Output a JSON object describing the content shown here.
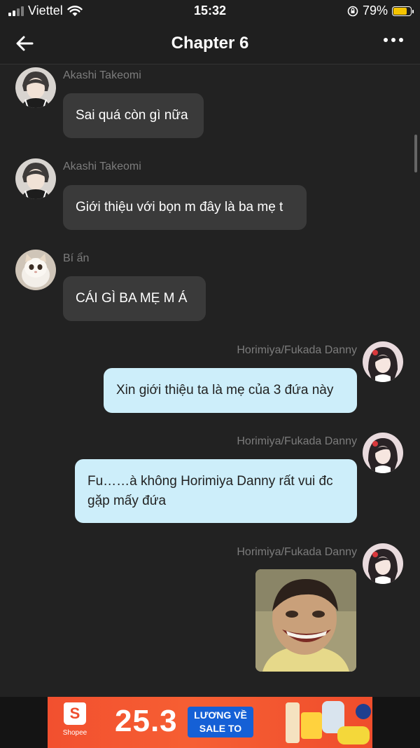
{
  "status_bar": {
    "carrier": "Viettel",
    "time": "15:32",
    "battery": "79%",
    "battery_level": 0.79
  },
  "header": {
    "title": "Chapter 6",
    "back_icon": "arrow-left-icon",
    "more_icon": "more-horizontal-icon"
  },
  "messages": [
    {
      "sender": "Akashi Takeomi",
      "text": "Sai quá còn gì nữa",
      "side": "in"
    },
    {
      "sender": "Akashi Takeomi",
      "text": "Giới thiệu với bọn m đây là ba mẹ t",
      "side": "in"
    },
    {
      "sender": "Bí ẩn",
      "text": "CÁI GÌ BA MẸ M Á",
      "side": "in"
    },
    {
      "sender": "Horimiya/Fukada Danny",
      "text": "Xin giới thiệu ta là mẹ của 3 đứa này",
      "side": "out"
    },
    {
      "sender": "Horimiya/Fukada Danny",
      "text": "Fu……à không Horimiya Danny rất vui đc gặp mấy đứa",
      "side": "out"
    },
    {
      "sender": "Horimiya/Fukada Danny",
      "text": "",
      "side": "out",
      "type": "image"
    }
  ],
  "ad": {
    "brand": "Shopee",
    "logo_letter": "S",
    "date": "25.3",
    "line1": "LƯƠNG VỀ",
    "line2": "SALE TO"
  },
  "colors": {
    "background": "#222222",
    "incoming_bubble": "#3a3a3a",
    "outgoing_bubble": "#cdeefa",
    "sender_name": "#7c7c7c",
    "ad_orange": "#f2502f",
    "ad_blue": "#1560d6"
  }
}
